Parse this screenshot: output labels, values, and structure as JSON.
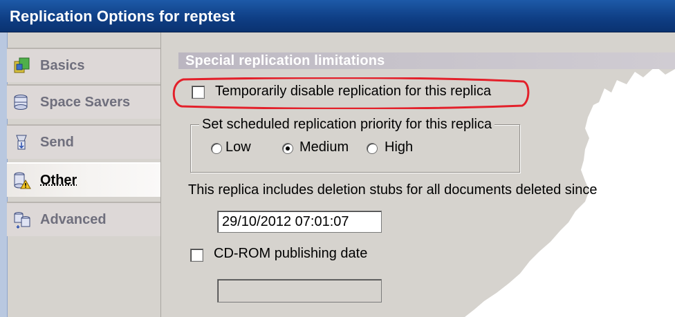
{
  "window": {
    "title": "Replication Options for reptest"
  },
  "sidebar": {
    "items": [
      {
        "label": "Basics",
        "icon": "basics-icon",
        "active": false
      },
      {
        "label": "Space Savers",
        "icon": "space-savers-icon",
        "active": false
      },
      {
        "label": "Send",
        "icon": "send-icon",
        "active": false
      },
      {
        "label": "Other",
        "icon": "other-icon",
        "active": true
      },
      {
        "label": "Advanced",
        "icon": "advanced-icon",
        "active": false
      }
    ]
  },
  "main": {
    "section_title": "Special replication limitations",
    "disable_replication": {
      "label": "Temporarily disable replication for this replica",
      "checked": false
    },
    "priority_group": {
      "legend": "Set scheduled replication priority for this replica",
      "options": [
        {
          "label": "Low",
          "selected": false
        },
        {
          "label": "Medium",
          "selected": true
        },
        {
          "label": "High",
          "selected": false
        }
      ]
    },
    "deletion_stubs_text": "This replica includes deletion stubs for all documents deleted since",
    "deletion_date": "29/10/2012 07:01:07",
    "cdrom": {
      "label": "CD-ROM publishing date",
      "checked": false,
      "value": ""
    }
  },
  "colors": {
    "titlebar": "#0f3f86",
    "highlight_ring": "#e3202a",
    "panel": "#d6d3ce"
  }
}
